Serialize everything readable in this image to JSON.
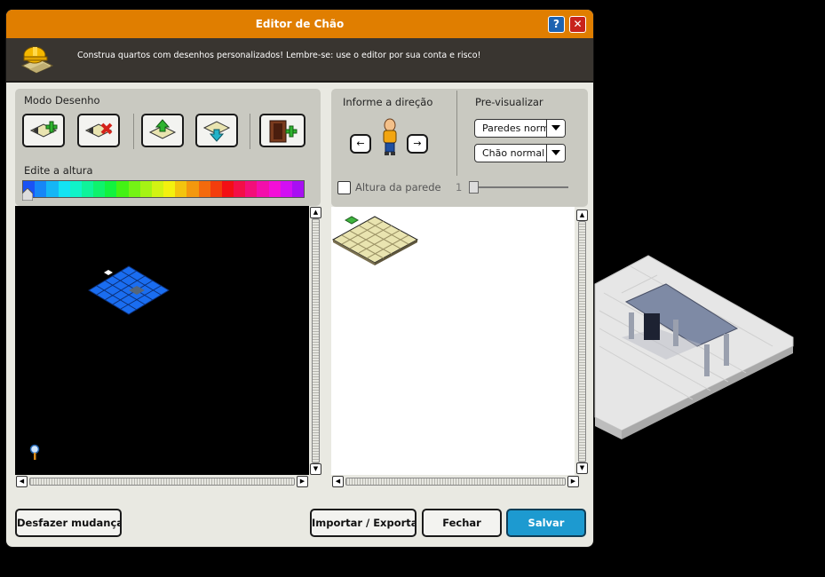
{
  "window": {
    "title": "Editor de Chão",
    "help_label": "?",
    "close_label": "✕"
  },
  "banner": {
    "text": "Construa quartos com desenhos personalizados! Lembre-se: use o editor por sua conta e risco!"
  },
  "draw_mode": {
    "label": "Modo Desenho",
    "tools": [
      "add-tile",
      "remove-tile",
      "raise-height",
      "lower-height",
      "place-door"
    ]
  },
  "height": {
    "label": "Edite a altura",
    "palette": [
      "#1a52f5",
      "#1686f7",
      "#15b6f5",
      "#13e3f3",
      "#10f3c8",
      "#0ff39a",
      "#0ff26c",
      "#12f23f",
      "#43f214",
      "#74f315",
      "#a5f314",
      "#d2f313",
      "#f3f10f",
      "#f3c40e",
      "#f3980e",
      "#f36a0d",
      "#f33d0d",
      "#f30f15",
      "#f30f47",
      "#f30f79",
      "#f30fab",
      "#f30fd8",
      "#d20ff3",
      "#a80ff3"
    ]
  },
  "direction": {
    "label": "Informe a direção",
    "left": "←",
    "right": "→"
  },
  "wall_height": {
    "label": "Altura da parede",
    "checked": false,
    "value": "1"
  },
  "preview": {
    "label": "Pre-visualizar",
    "walls_select": "Paredes normais",
    "floor_select": "Chão normal"
  },
  "buttons": {
    "undo": "Desfazer mudanças",
    "import_export": "Importar / Exportar",
    "close": "Fechar",
    "save": "Salvar"
  },
  "colors": {
    "titlebar": "#e07e00",
    "save": "#1d9ad0",
    "tile_blue": "#1a6df0",
    "tile_preview": "#e9e4b0"
  }
}
